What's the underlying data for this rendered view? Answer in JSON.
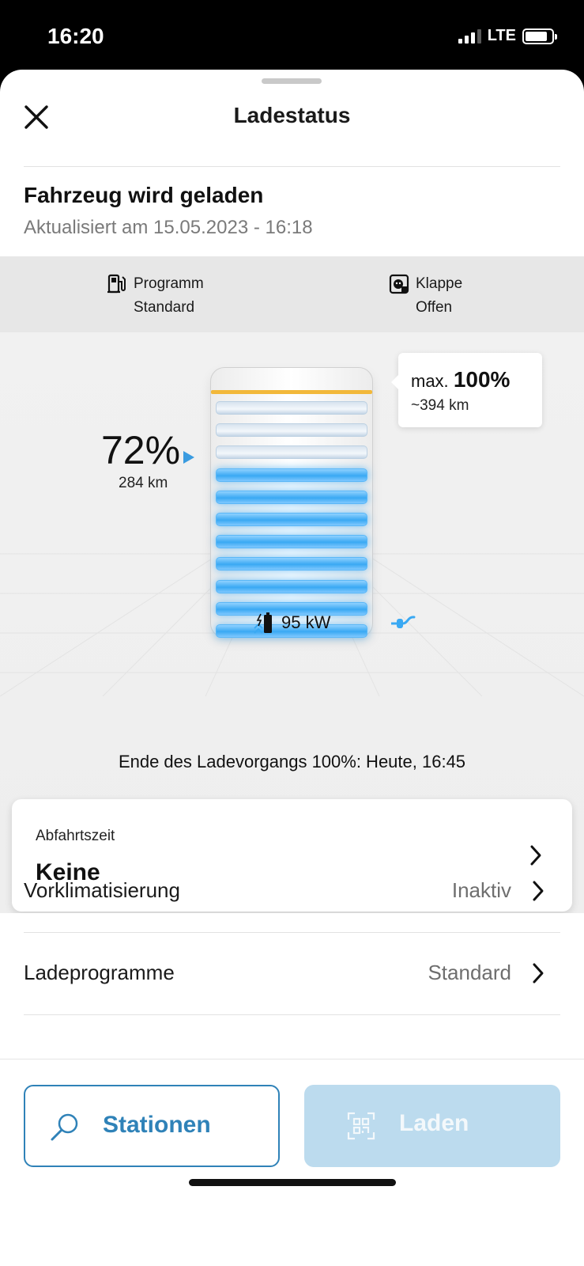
{
  "status_bar": {
    "time": "16:20",
    "network": "LTE",
    "signal_bars": 3,
    "battery_level": 0.85
  },
  "header": {
    "title": "Ladestatus",
    "close_icon": "close-icon"
  },
  "status": {
    "title": "Fahrzeug wird geladen",
    "updated": "Aktualisiert am 15.05.2023 - 16:18"
  },
  "info": {
    "program": {
      "label": "Programm",
      "value": "Standard",
      "icon": "charging-station-icon"
    },
    "flap": {
      "label": "Klappe",
      "value": "Offen",
      "icon": "charging-flap-icon"
    }
  },
  "battery": {
    "soc_percent": "72%",
    "soc_value": 72,
    "range": "284 km",
    "max_prefix": "max.",
    "max_value": "100%",
    "max_range": "~394 km",
    "power": "95 kW",
    "end_text": "Ende des Ladevorgangs 100%: Heute, 16:45",
    "cells_total": 11,
    "cells_filled": 8,
    "colors": {
      "filled": "#3aa9f3",
      "limit_line": "#f2b83a"
    }
  },
  "departure": {
    "label": "Abfahrtszeit",
    "value": "Keine"
  },
  "list": [
    {
      "label": "Vorklimatisierung",
      "value": "Inaktiv"
    },
    {
      "label": "Ladeprogramme",
      "value": "Standard"
    }
  ],
  "buttons": {
    "stations": "Stationen",
    "charge": "Laden",
    "accent": "#2f82b8"
  }
}
